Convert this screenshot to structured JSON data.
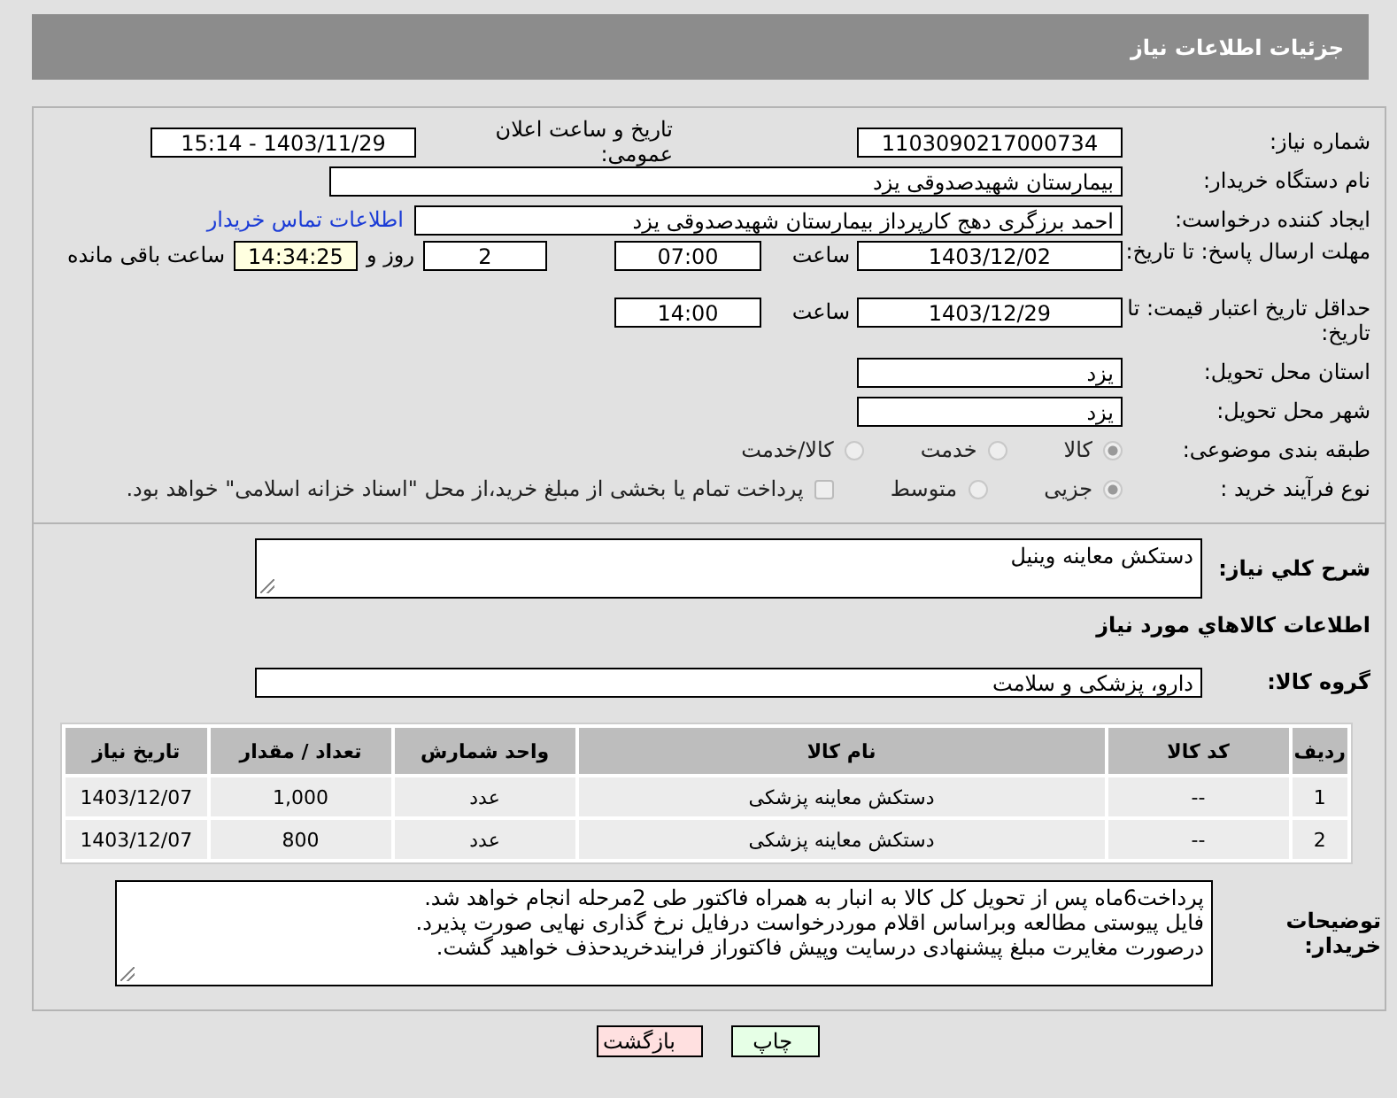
{
  "title": "جزئیات اطلاعات نیاز",
  "need_number": {
    "label": "شماره نیاز:",
    "value": "1103090217000734"
  },
  "announce": {
    "label": "تاریخ و ساعت اعلان عمومی:",
    "value": "1403/11/29 - 15:14"
  },
  "buyer_org": {
    "label": "نام دستگاه خریدار:",
    "value": "بیمارستان شهیدصدوقی یزد"
  },
  "requester": {
    "label": "ایجاد کننده درخواست:",
    "value": "احمد برزگری دهج کارپرداز بیمارستان شهیدصدوقی یزد",
    "link": "اطلاعات تماس خریدار"
  },
  "response_deadline": {
    "label": "مهلت ارسال پاسخ: تا تاریخ:",
    "date": "1403/12/02",
    "time_label": "ساعت",
    "time": "07:00",
    "days": "2",
    "days_label": "روز و",
    "remaining": "14:34:25",
    "remaining_label": "ساعت باقی مانده"
  },
  "price_validity": {
    "label": "حداقل تاریخ اعتبار قیمت: تا تاریخ:",
    "date": "1403/12/29",
    "time_label": "ساعت",
    "time": "14:00"
  },
  "province": {
    "label": "استان محل تحویل:",
    "value": "یزد"
  },
  "city": {
    "label": "شهر محل تحویل:",
    "value": "یزد"
  },
  "category": {
    "label": "طبقه بندی موضوعی:",
    "options": [
      {
        "label": "کالا",
        "selected": true
      },
      {
        "label": "خدمت",
        "selected": false
      },
      {
        "label": "کالا/خدمت",
        "selected": false
      }
    ]
  },
  "process": {
    "label": "نوع فرآیند خرید :",
    "options": [
      {
        "label": "جزیی",
        "selected": true
      },
      {
        "label": "متوسط",
        "selected": false
      }
    ],
    "payment": {
      "label": "پرداخت تمام یا بخشی از مبلغ خرید،از محل \"اسناد خزانه اسلامی\" خواهد بود.",
      "checked": false
    }
  },
  "description": {
    "label": "شرح کلي نياز:",
    "value": "دستکش معاینه وینیل"
  },
  "items_heading": "اطلاعات کالاهاي مورد نياز",
  "goods_group": {
    "label": "گروه کالا:",
    "value": "دارو، پزشکی و سلامت"
  },
  "table": {
    "columns": [
      "ردیف",
      "کد کالا",
      "نام کالا",
      "واحد شمارش",
      "تعداد / مقدار",
      "تاریخ نیاز"
    ],
    "rows": [
      [
        "1",
        "--",
        "دستکش معاینه پزشکی",
        "عدد",
        "1,000",
        "1403/12/07"
      ],
      [
        "2",
        "--",
        "دستکش معاینه پزشکی",
        "عدد",
        "800",
        "1403/12/07"
      ]
    ]
  },
  "buyer_notes": {
    "label": "توضیحات خریدار:",
    "value": "پرداخت6ماه پس از تحویل کل کالا به انبار به همراه فاکتور طی 2مرحله انجام خواهد شد.\nفایل پیوستی مطالعه وبراساس اقلام موردرخواست درفایل نرخ گذاری نهایی  صورت پذیرد.\nدرصورت مغایرت مبلغ پیشنهادی درسایت وپیش فاکتوراز فرایندخریدحذف خواهید گشت."
  },
  "buttons": [
    {
      "label": "چاپ",
      "kind": "print"
    },
    {
      "label": "بازگشت",
      "kind": "back"
    }
  ]
}
